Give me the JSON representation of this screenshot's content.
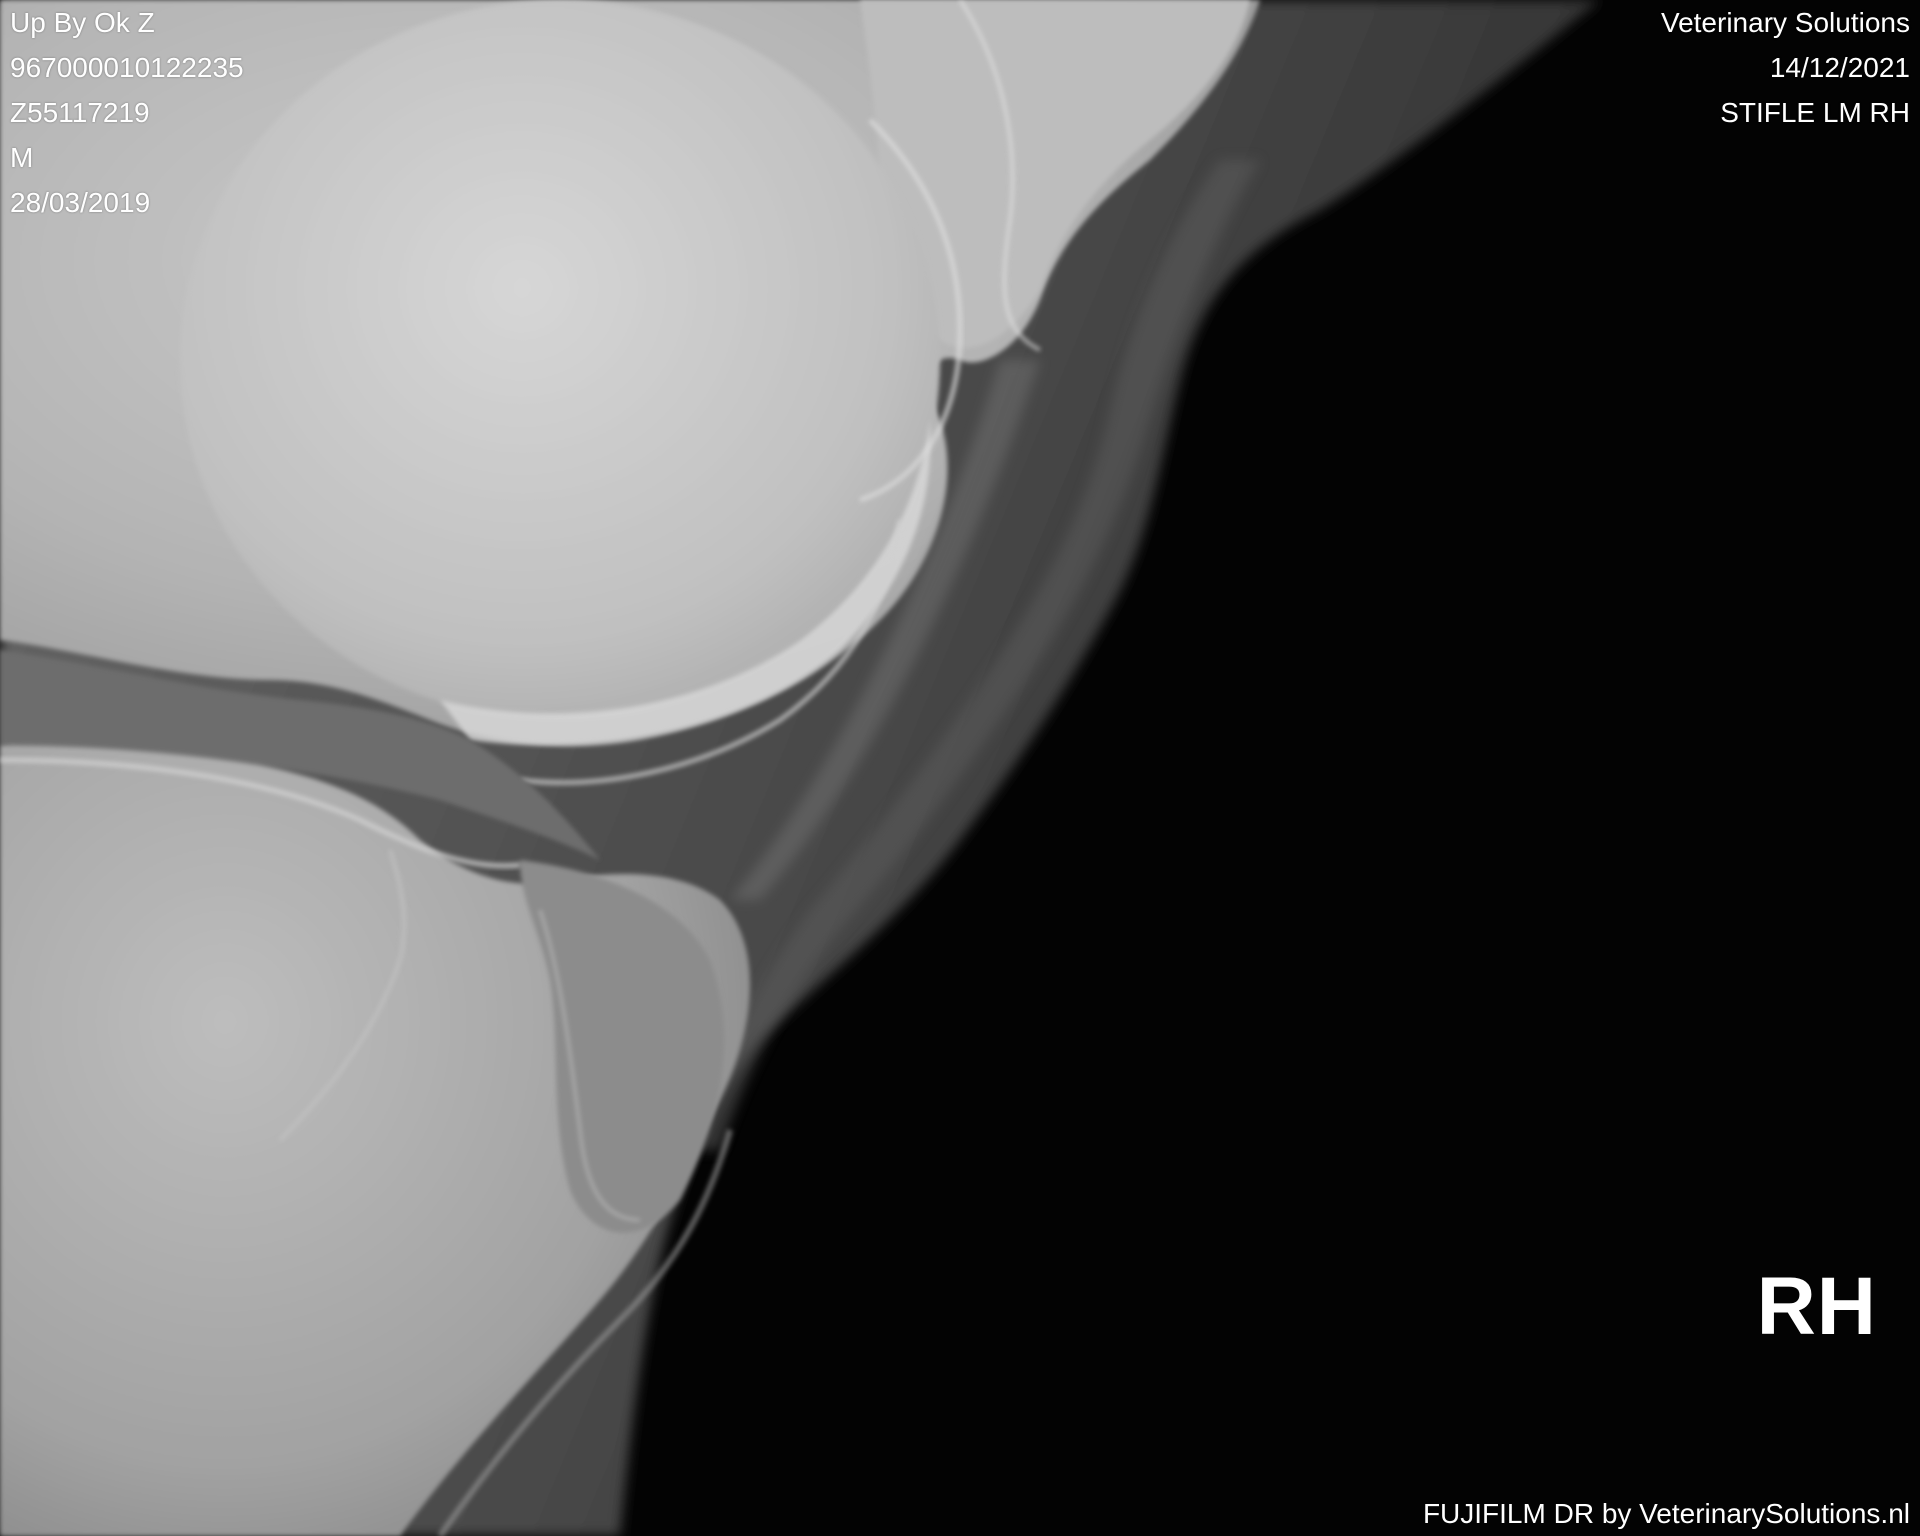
{
  "patient": {
    "name": "Up By Ok Z",
    "chip_id": "967000010122235",
    "patient_id": "Z55117219",
    "sex": "M",
    "birth_date": "28/03/2019"
  },
  "study": {
    "clinic": "Veterinary Solutions",
    "date": "14/12/2021",
    "view": "STIFLE LM RH"
  },
  "side_marker": "RH",
  "footer": {
    "brand": "FUJIFILM DR by VeterinarySolutions.nl"
  }
}
